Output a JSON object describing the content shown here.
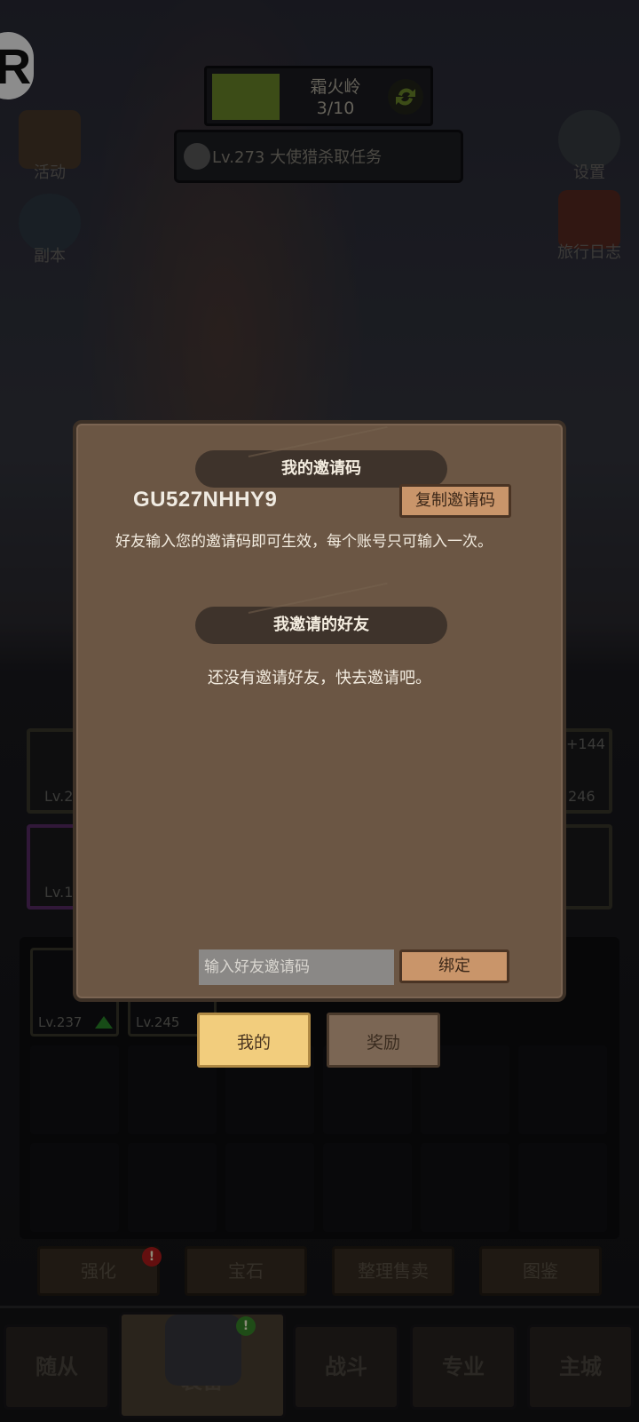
{
  "hud": {
    "badge_letter": "R",
    "stage_name": "霜火岭",
    "stage_progress": "3/10",
    "task_text": "Lv.273 大使猎杀取任务"
  },
  "side_left": [
    {
      "label": "活动",
      "icon": "activity-icon"
    },
    {
      "label": "副本",
      "icon": "dungeon-icon"
    }
  ],
  "side_right": [
    {
      "label": "设置",
      "icon": "gear-icon"
    },
    {
      "label": "旅行日志",
      "icon": "journal-icon"
    }
  ],
  "equipment_slots": {
    "left_top_lv": "Lv.2",
    "left_bottom_lv": "Lv.1",
    "right_top_plus": "+144",
    "right_top_lv": "246"
  },
  "inventory": {
    "item1_lv": "Lv.237",
    "item2_lv": "Lv.245"
  },
  "actions": [
    "强化",
    "宝石",
    "整理售卖",
    "图鉴"
  ],
  "bottom_nav": [
    "随从",
    "装备",
    "战斗",
    "专业",
    "主城"
  ],
  "dialog": {
    "my_code_header": "我的邀请码",
    "invite_code": "GU527NHHY9",
    "copy_button": "复制邀请码",
    "description": "好友输入您的邀请码即可生效，每个账号只可输入一次。",
    "friends_header": "我邀请的好友",
    "empty_text": "还没有邀请好友，快去邀请吧。",
    "input_placeholder": "输入好友邀请码",
    "bind_button": "绑定"
  },
  "dialog_tabs": {
    "mine": "我的",
    "reward": "奖励"
  },
  "colors": {
    "dialog_bg": "#6b5644",
    "header_bg": "#3e332b",
    "active_tab": "#f2cd7d",
    "wood_button": "#c9956a"
  }
}
